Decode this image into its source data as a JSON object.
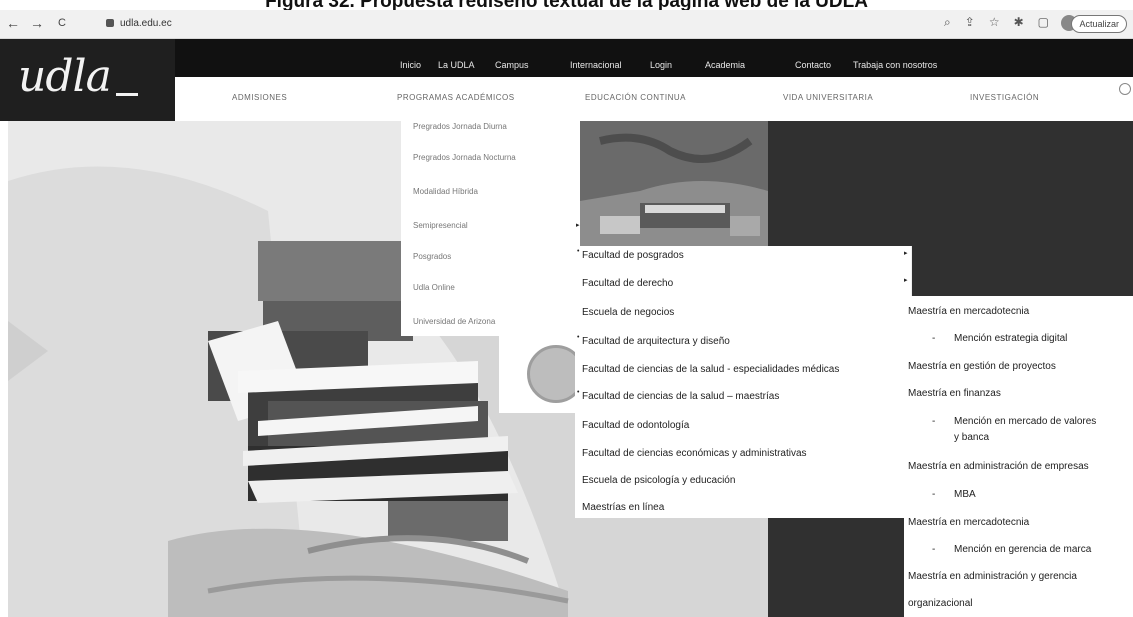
{
  "caption": "Figura 32. Propuesta rediseño textual de la página web de la UDLA",
  "browser": {
    "back": "←",
    "forward": "→",
    "reload": "C",
    "url": "udla.edu.ec",
    "update_button": "Actualizar"
  },
  "logo": {
    "text": "udla"
  },
  "utility_nav": [
    "Inicio",
    "La UDLA",
    "Campus",
    "Internacional",
    "Login",
    "Academia",
    "Contacto",
    "Trabaja con nosotros"
  ],
  "main_nav": [
    "ADMISIONES",
    "PROGRAMAS ACADÉMICOS",
    "EDUCACIÓN CONTINUA",
    "VIDA UNIVERSITARIA",
    "INVESTIGACIÓN"
  ],
  "dropdown_programs": [
    "Pregrados Jornada Diurna",
    "Pregrados Jornada Nocturna",
    "Modalidad Híbrida",
    "Semipresencial",
    "Posgrados",
    "Udla Online",
    "Universidad de Arizona"
  ],
  "dropdown_faculties": [
    "Facultad de posgrados",
    "Facultad de derecho",
    "Escuela de negocios",
    "Facultad de arquitectura y diseño",
    "Facultad de ciencias de la salud - especialidades médicas",
    "Facultad de ciencias de la salud – maestrías",
    "Facultad de odontología",
    "Facultad de ciencias económicas y administrativas",
    "Escuela de psicología y educación",
    "Maestrías en línea"
  ],
  "dropdown_masters": {
    "m1": "Maestría en mercadotecnia",
    "m1_sub": "Mención estrategia digital",
    "m2": "Maestría en gestión de proyectos",
    "m3": "Maestría en finanzas",
    "m3_sub_line1": "Mención en mercado de valores",
    "m3_sub_line2": "y banca",
    "m4": "Maestría en administración de empresas",
    "m4_sub": "MBA",
    "m5": "Maestría en mercadotecnia",
    "m5_sub": "Mención en gerencia de marca",
    "m6_line1": "Maestría en administración y gerencia",
    "m6_line2": "organizacional"
  },
  "colors": {
    "header_bg": "#111111",
    "logo_bg": "#1f1f1f",
    "panel_bg": "#303030"
  }
}
